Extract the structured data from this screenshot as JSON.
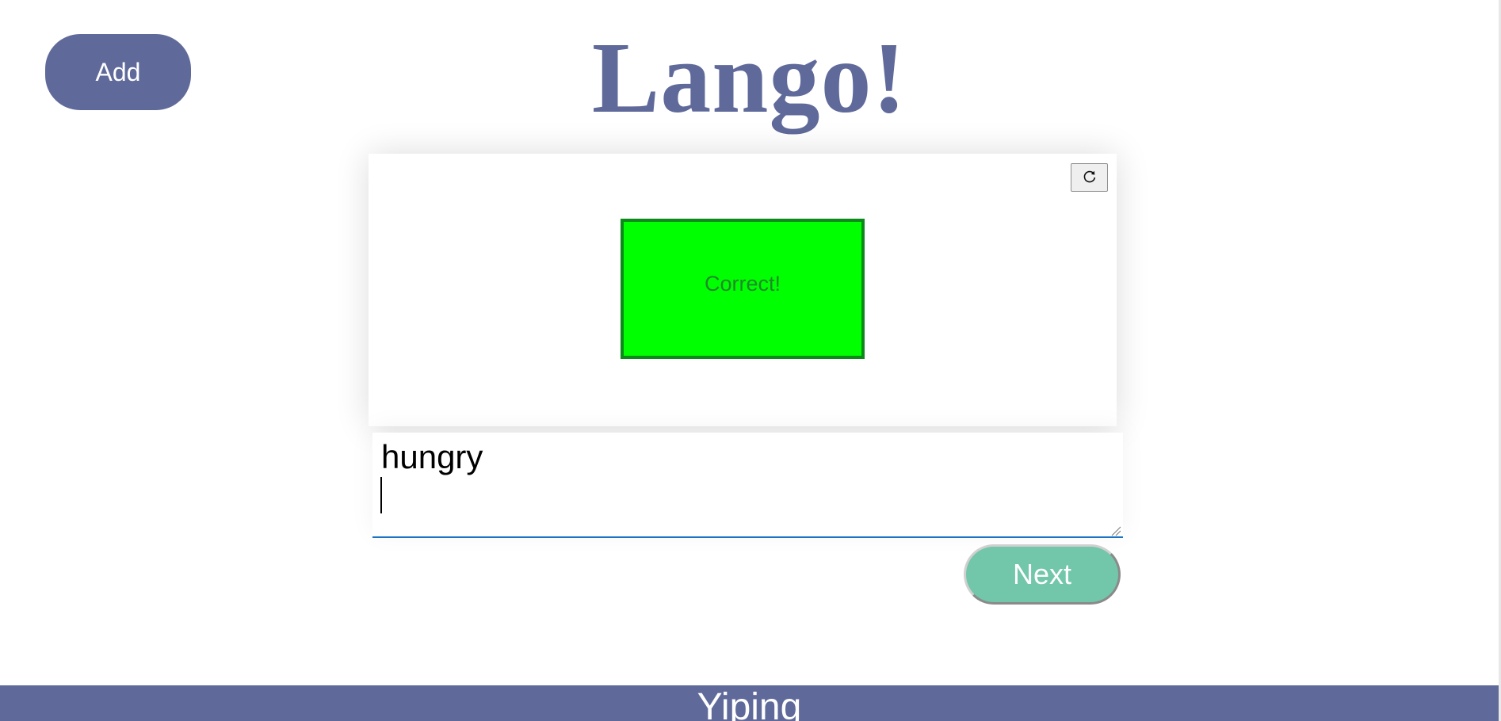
{
  "header": {
    "title": "Lango!",
    "add_label": "Add"
  },
  "card": {
    "refresh_icon": "refresh-icon",
    "feedback": "Correct!"
  },
  "answer": {
    "value": "hungry"
  },
  "actions": {
    "next_label": "Next"
  },
  "footer": {
    "text": "Yiping"
  },
  "colors": {
    "brand": "#606a9a",
    "correct_fill": "#00ff00",
    "correct_border": "#0b8a1a",
    "next_button": "#72c6aa",
    "input_underline": "#1c73c4"
  }
}
